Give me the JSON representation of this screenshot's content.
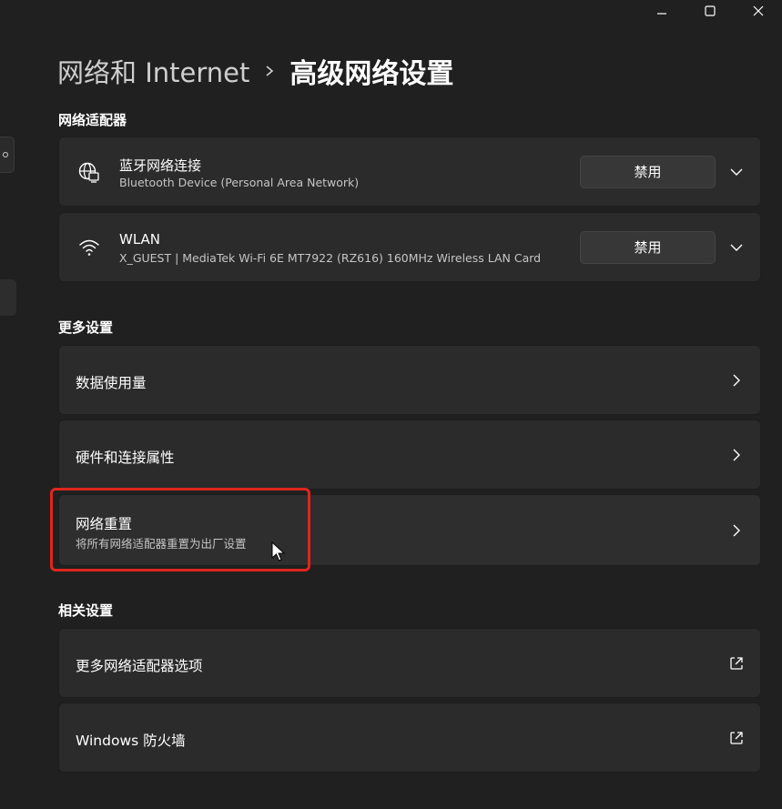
{
  "breadcrumb": {
    "parent": "网络和 Internet",
    "current": "高级网络设置"
  },
  "sections": {
    "adapters_title": "网络适配器",
    "more_title": "更多设置",
    "related_title": "相关设置"
  },
  "adapters": [
    {
      "name": "蓝牙网络连接",
      "description": "Bluetooth Device (Personal Area Network)",
      "button": "禁用",
      "icon": "network-adapter-icon"
    },
    {
      "name": "WLAN",
      "description": "X_GUEST | MediaTek Wi-Fi 6E MT7922 (RZ616) 160MHz Wireless LAN Card",
      "button": "禁用",
      "icon": "wifi-icon"
    }
  ],
  "more_settings": [
    {
      "label": "数据使用量"
    },
    {
      "label": "硬件和连接属性"
    },
    {
      "label": "网络重置",
      "sublabel": "将所有网络适配器重置为出厂设置"
    }
  ],
  "related_settings": [
    {
      "label": "更多网络适配器选项"
    },
    {
      "label": "Windows 防火墙"
    }
  ],
  "colors": {
    "background": "#202020",
    "card": "#2b2b2b",
    "button": "#373737",
    "highlight": "#e0261d"
  }
}
